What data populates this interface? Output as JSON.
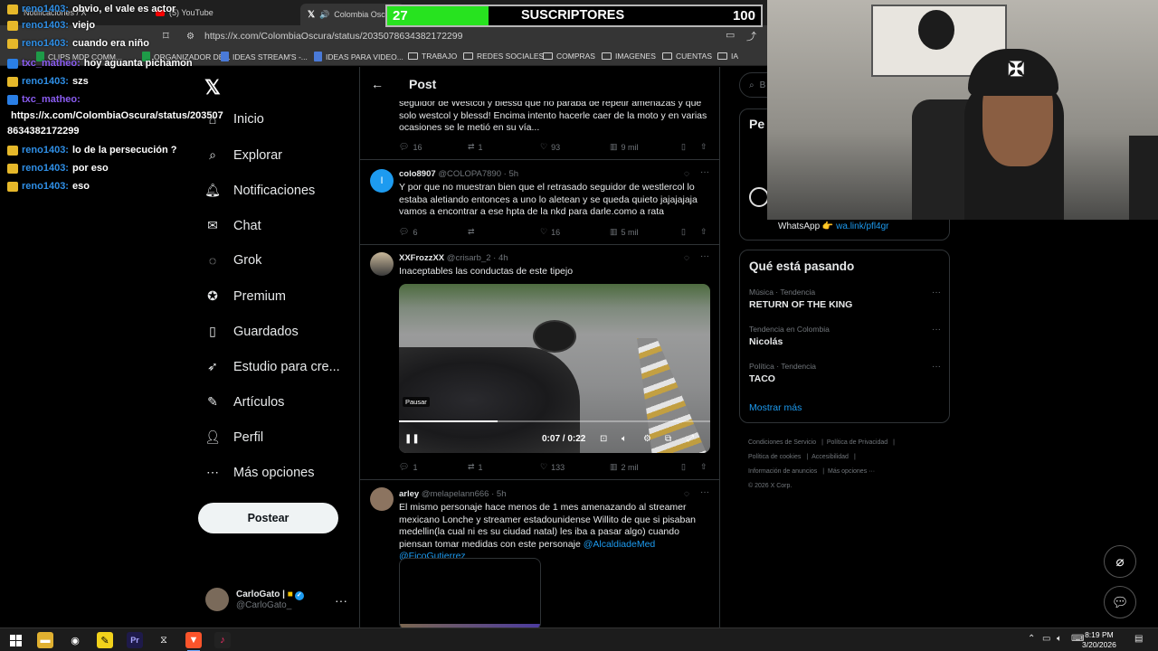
{
  "browser": {
    "tabs": [
      {
        "label": "Notificaciones / X"
      },
      {
        "label": "(5) YouTube"
      },
      {
        "label": "Colombia Oscura"
      }
    ],
    "url": "https://x.com/ColombiaOscura/status/2035078634382172299",
    "bookmarks": [
      {
        "label": "CLIPS MDP COMM...",
        "icon": "sheet-icon"
      },
      {
        "label": "ORGANIZADOR DE...",
        "icon": "sheet-icon"
      },
      {
        "label": "IDEAS STREAM'S -...",
        "icon": "doc-icon"
      },
      {
        "label": "IDEAS PARA VIDEO...",
        "icon": "doc-icon"
      },
      {
        "label": "TRABAJO",
        "icon": "folder-icon"
      },
      {
        "label": "REDES SOCIALES",
        "icon": "folder-icon"
      },
      {
        "label": "COMPRAS",
        "icon": "folder-icon"
      },
      {
        "label": "IMAGENES",
        "icon": "folder-icon"
      },
      {
        "label": "CUENTAS",
        "icon": "folder-icon"
      },
      {
        "label": "IA",
        "icon": "folder-icon"
      }
    ]
  },
  "chat": {
    "lines": [
      {
        "user": "reno1403:",
        "msg": "obvio, el vale es actor",
        "badge": "yellow"
      },
      {
        "user": "reno1403:",
        "msg": "viejo",
        "badge": "yellow"
      },
      {
        "user": "reno1403:",
        "msg": "cuando era niño",
        "badge": "yellow"
      },
      {
        "user": "txc_matheo:",
        "msg": "hoy aguanta pichamon",
        "badge": "blue"
      },
      {
        "user": "reno1403:",
        "msg": "szs",
        "badge": "yellow"
      },
      {
        "user": "txc_matheo:",
        "msg": "",
        "badge": "blue"
      },
      {
        "user": "",
        "msg": "https://x.com/ColombiaOscura/status/203507",
        "badge": ""
      },
      {
        "user": "",
        "msg": "8634382172299",
        "badge": ""
      },
      {
        "user": "reno1403:",
        "msg": "lo de la persecución ?",
        "badge": "yellow"
      },
      {
        "user": "reno1403:",
        "msg": "por eso",
        "badge": "yellow"
      },
      {
        "user": "reno1403:",
        "msg": "eso",
        "badge": "yellow"
      }
    ]
  },
  "subscribers": {
    "current": "27",
    "label": "SUSCRIPTORES",
    "goal": "100",
    "progress": 0.27
  },
  "sidebar": {
    "items": [
      {
        "label": "Inicio",
        "icon": "home-icon"
      },
      {
        "label": "Explorar",
        "icon": "search-icon"
      },
      {
        "label": "Notificaciones",
        "icon": "bell-icon"
      },
      {
        "label": "Chat",
        "icon": "mail-icon"
      },
      {
        "label": "Grok",
        "icon": "grok-icon"
      },
      {
        "label": "Premium",
        "icon": "premium-icon"
      },
      {
        "label": "Guardados",
        "icon": "bookmark-icon"
      },
      {
        "label": "Estudio para cre...",
        "icon": "rocket-icon"
      },
      {
        "label": "Artículos",
        "icon": "article-icon"
      },
      {
        "label": "Perfil",
        "icon": "person-icon"
      },
      {
        "label": "Más opciones",
        "icon": "more-icon"
      }
    ],
    "post_button": "Postear",
    "account": {
      "name": "CarloGato |",
      "handle": "@CarloGato_"
    }
  },
  "main": {
    "title": "Post",
    "tweets": [
      {
        "text": "seguidor de Westcol y blessd que no paraba de repetir amenazas y que solo westcol y blessd! Encima intento hacerle caer de la moto y en varias ocasiones se le metió en su vía...",
        "replies": "16",
        "reposts": "1",
        "likes": "93",
        "views": "9 mil"
      },
      {
        "name": "colo8907",
        "handle": "@COLOPA7890",
        "time": "5h",
        "text": "Y por que no muestran bien que el retrasado seguidor de westlercol lo estaba aletiando entonces a uno lo aletean y se queda quieto jajajajaja vamos a encontrar a ese hpta de la nkd para darle.como a rata",
        "replies": "6",
        "reposts": "",
        "likes": "16",
        "views": "5 mil"
      },
      {
        "name": "XXFrozzXX",
        "handle": "@crisarb_2",
        "time": "4h",
        "text": "Inaceptables las conductas de este tipejo",
        "video": {
          "time": "0:07 / 0:22",
          "tooltip": "Pausar",
          "progress": 0.318
        },
        "replies": "1",
        "reposts": "1",
        "likes": "133",
        "views": "2 mil"
      },
      {
        "name": "arley",
        "handle": "@melapelann666",
        "time": "5h",
        "text": "El mismo personaje hace menos de 1 mes amenazando al streamer mexicano Lonche y streamer estadounidense Willito de que si pisaban medellin(la cual ni es su ciudad natal) les iba a pasar algo) cuando piensan tomar medidas con este personaje ",
        "mentions": "@AlcaldiadeMed @FicoGutierrez"
      }
    ]
  },
  "right": {
    "search_placeholder": "B",
    "premium_title": "Pe",
    "whatsapp_text": "WhatsApp 👉 ",
    "whatsapp_link": "wa.link/pfl4gr",
    "trends_title": "Qué está pasando",
    "trends": [
      {
        "context": "Música · Tendencia",
        "name": "RETURN OF THE KING"
      },
      {
        "context": "Tendencia en Colombia",
        "name": "Nicolás"
      },
      {
        "context": "Política · Tendencia",
        "name": "TACO"
      }
    ],
    "show_more": "Mostrar más",
    "footer": {
      "l1a": "Condiciones de Servicio",
      "l1b": "Política de Privacidad",
      "l2a": "Política de cookies",
      "l2b": "Accesibilidad",
      "l3a": "Información de anuncios",
      "l3b": "Más opciones ···",
      "copyright": "© 2026 X Corp."
    }
  },
  "taskbar": {
    "time": "8:19 PM",
    "date": "3/20/2026"
  },
  "colors": {
    "accent": "#1d9bf0",
    "progress_green": "#27e31f"
  }
}
